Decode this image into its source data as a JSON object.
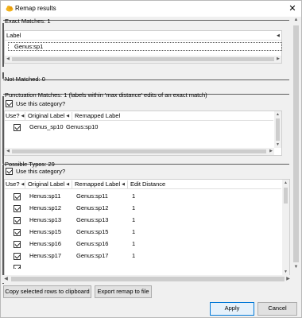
{
  "window": {
    "title": "Remap results",
    "close_glyph": "✕"
  },
  "sections": {
    "exact": {
      "title": "Exact Matches: 1",
      "columns": [
        "Label"
      ],
      "rows": [
        {
          "label": "Genus:sp1"
        }
      ]
    },
    "not_matched": {
      "title": "Not Matched: 0"
    },
    "punctuation": {
      "title": "Punctuation Matches: 1 (labels within 'max distance' edits of an exact match)",
      "use_category_label": "Use this category?",
      "use_category_checked": true,
      "columns": [
        "Use?",
        "Original Label",
        "Remapped Label"
      ],
      "rows": [
        {
          "use": true,
          "original": "Genus_sp10",
          "remapped": "Genus:sp10"
        }
      ]
    },
    "typos": {
      "title": "Possible Typos: 29",
      "use_category_label": "Use this category?",
      "use_category_checked": true,
      "columns": [
        "Use?",
        "Original Label",
        "Remapped Label",
        "Edit Distance"
      ],
      "rows": [
        {
          "use": true,
          "original": "Henus:sp11",
          "remapped": "Genus:sp11",
          "distance": "1"
        },
        {
          "use": true,
          "original": "Henus:sp12",
          "remapped": "Genus:sp12",
          "distance": "1"
        },
        {
          "use": true,
          "original": "Henus:sp13",
          "remapped": "Genus:sp13",
          "distance": "1"
        },
        {
          "use": true,
          "original": "Henus:sp15",
          "remapped": "Genus:sp15",
          "distance": "1"
        },
        {
          "use": true,
          "original": "Henus:sp16",
          "remapped": "Genus:sp16",
          "distance": "1"
        },
        {
          "use": true,
          "original": "Henus:sp17",
          "remapped": "Genus:sp17",
          "distance": "1"
        }
      ]
    }
  },
  "buttons": {
    "copy": "Copy selected rows to clipboard",
    "export": "Export remap to file",
    "apply": "Apply",
    "cancel": "Cancel"
  },
  "icons": {
    "app": "cloud-icon",
    "sort": "sort-arrow-icon",
    "scroll_up": "▲",
    "scroll_down": "▼",
    "scroll_left": "◀",
    "scroll_right": "▶"
  },
  "colors": {
    "accent": "#0078d7",
    "section_line": "#5b5b5b",
    "app_icon": "#f2b21c"
  }
}
